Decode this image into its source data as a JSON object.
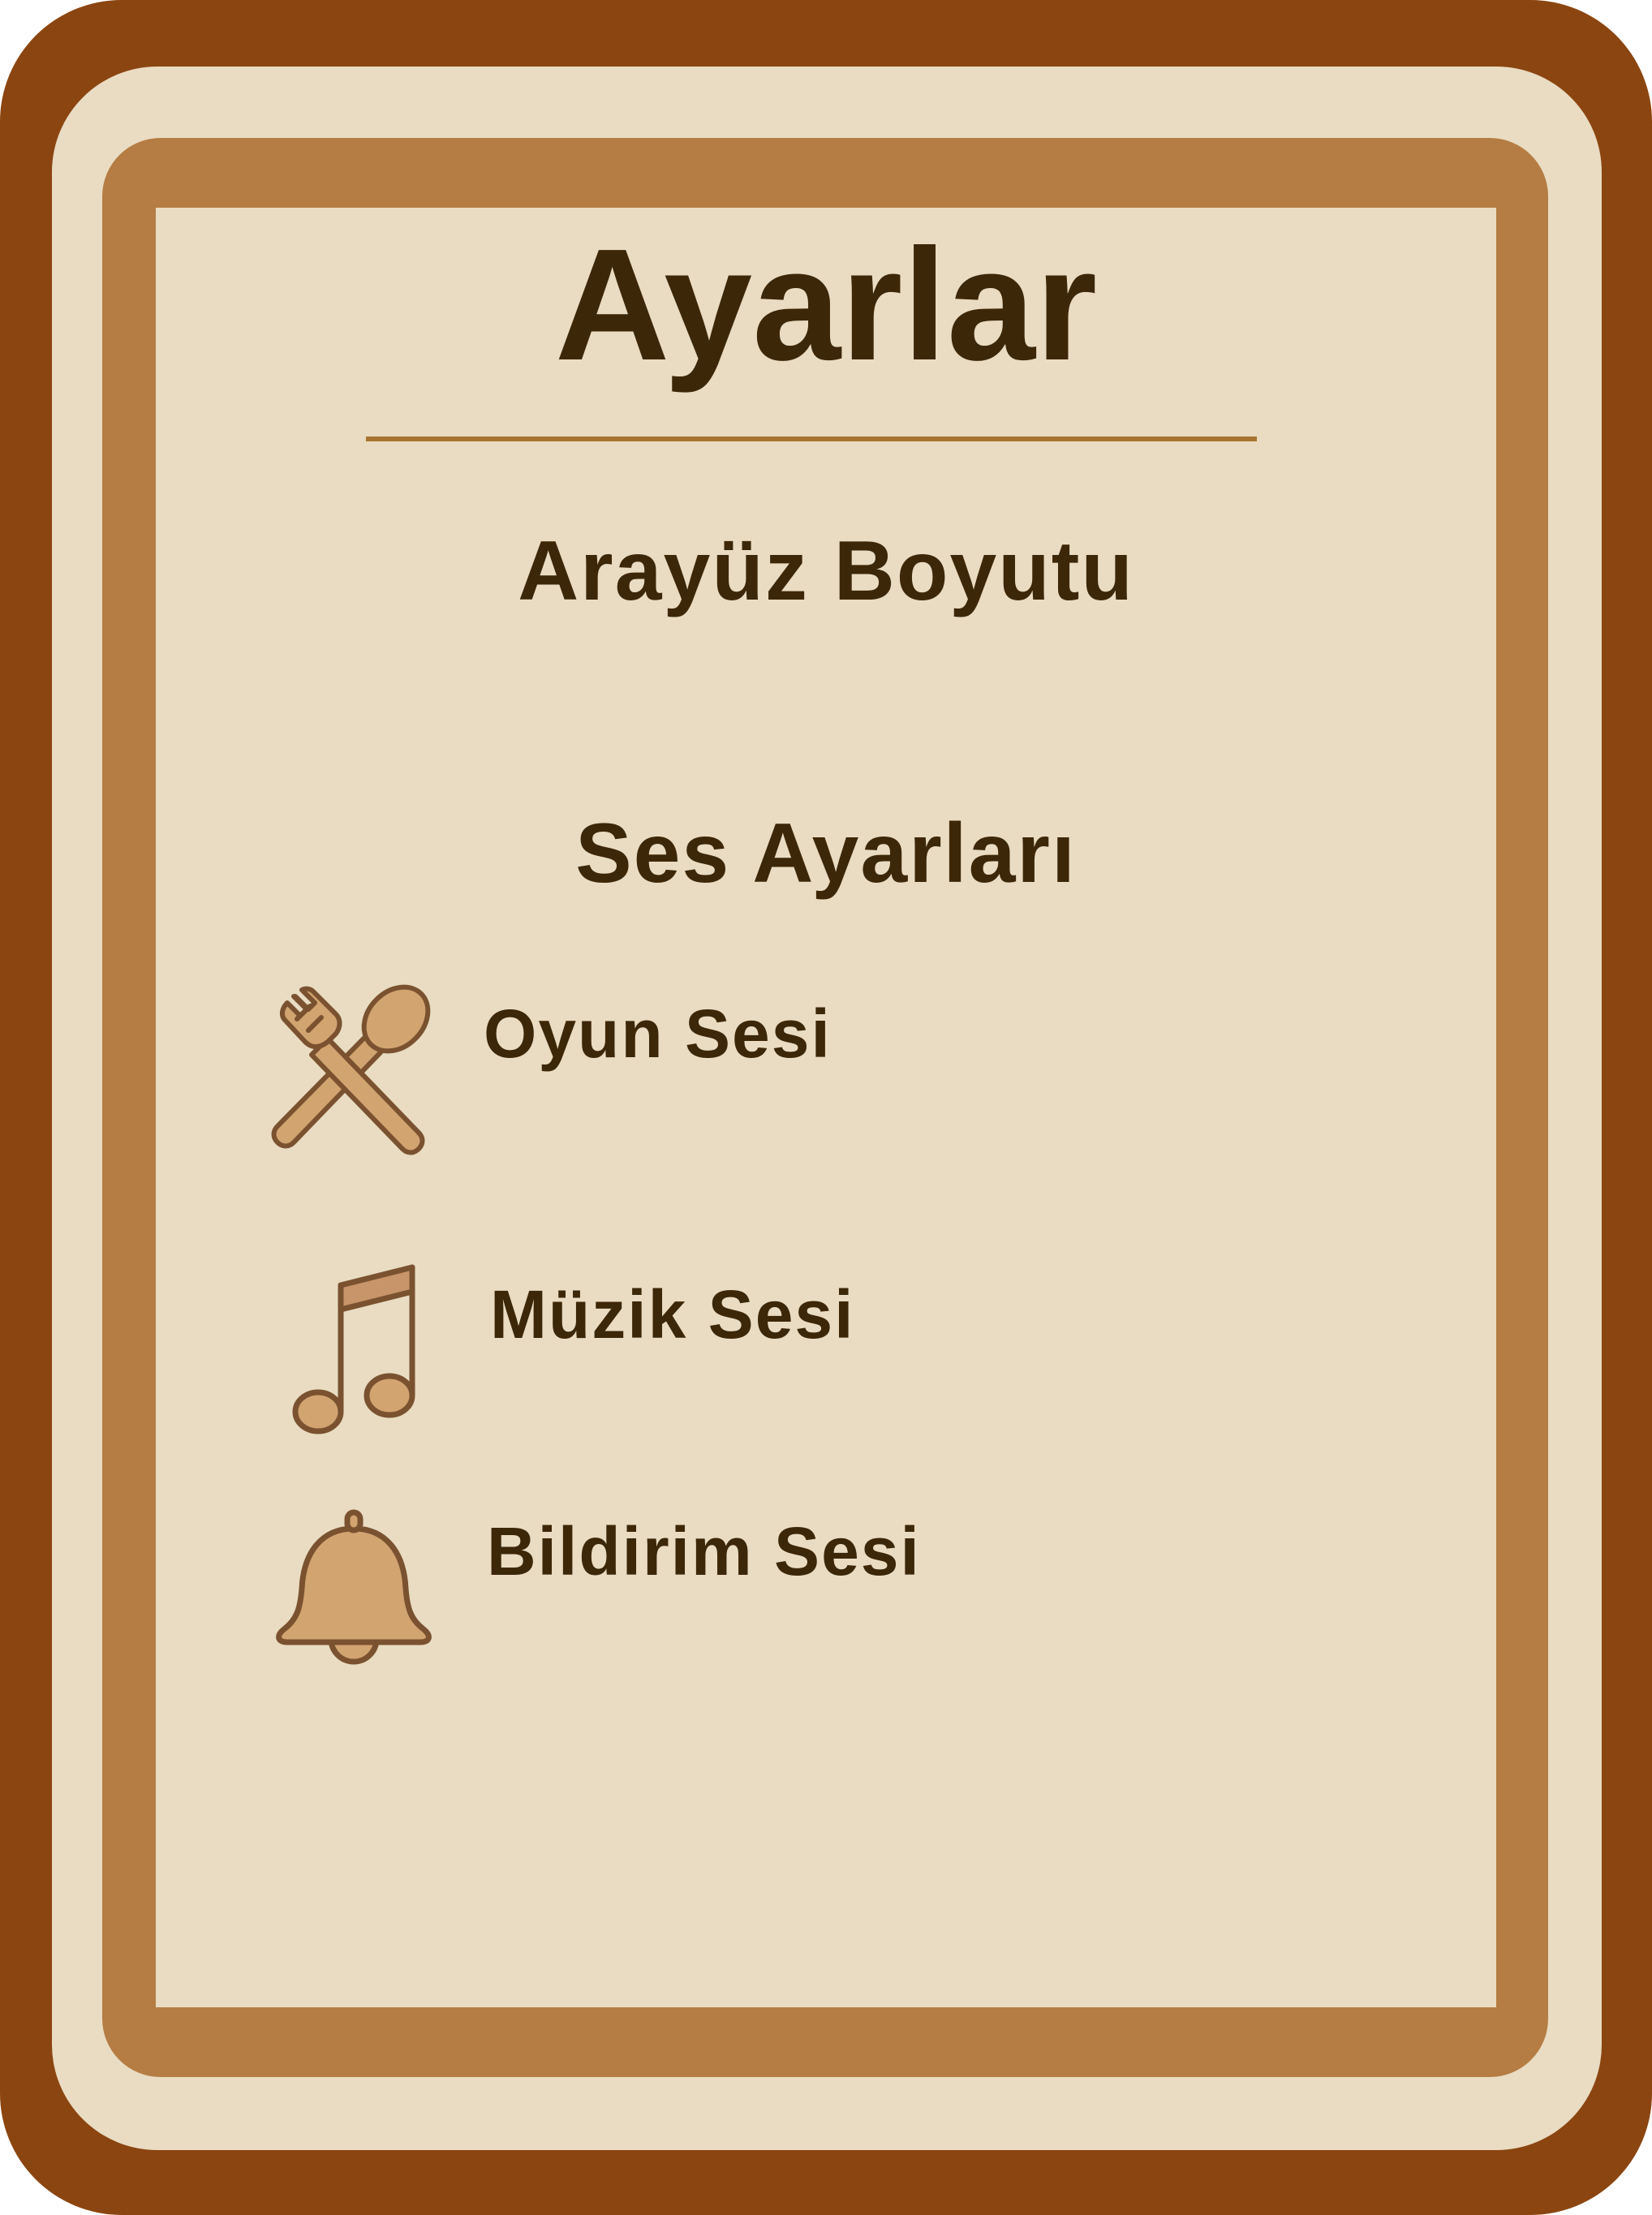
{
  "settings_panel": {
    "title": "Ayarlar",
    "sections": {
      "interface": {
        "heading": "Arayüz Boyutu"
      },
      "sound": {
        "heading": "Ses Ayarları",
        "items": [
          {
            "label": "Oyun Sesi",
            "icon": "fork-spoon-icon"
          },
          {
            "label": "Müzik Sesi",
            "icon": "music-note-icon"
          },
          {
            "label": "Bildirim Sesi",
            "icon": "bell-icon"
          }
        ]
      }
    }
  },
  "colors": {
    "frame_brown": "#8B4510",
    "tan_border": "#B57D43",
    "cream": "#E9DCC2",
    "text_dark_brown": "#3D2709",
    "divider": "#A8742F",
    "icon_fill": "#D2A470",
    "icon_stroke": "#7A5230"
  }
}
